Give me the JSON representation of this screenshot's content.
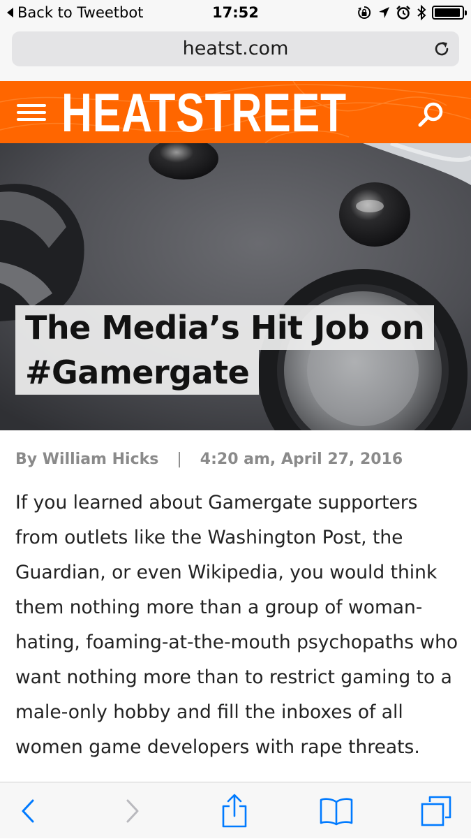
{
  "status_bar": {
    "back_label": "Back to Tweetbot",
    "time": "17:52",
    "icons": [
      "orientation-lock-icon",
      "location-arrow-icon",
      "alarm-icon",
      "bluetooth-icon",
      "battery-icon"
    ],
    "battery_level": 0.95
  },
  "browser": {
    "url": "heatst.com",
    "accent_color": "#007aff"
  },
  "site": {
    "logo": "HEATSTREET",
    "brand_color": "#ff6600"
  },
  "article": {
    "headline_line1": "The Media’s Hit Job on",
    "headline_line2": "#Gamergate",
    "author": "By William Hicks",
    "separator": "|",
    "date": "4:20 am, April 27, 2016",
    "body": "If you learned about Gamergate supporters from outlets like the Washington Post, the Guardian, or even Wikipedia, you would think them nothing more than a group of woman-hating, foaming-at-the-mouth psychopaths who want nothing more than to restrict gaming to a male-only hobby and fill the inboxes of all women game developers with rape threats."
  },
  "toolbar": {
    "icons": [
      "back-icon",
      "forward-icon",
      "share-icon",
      "bookmarks-icon",
      "tabs-icon"
    ]
  }
}
